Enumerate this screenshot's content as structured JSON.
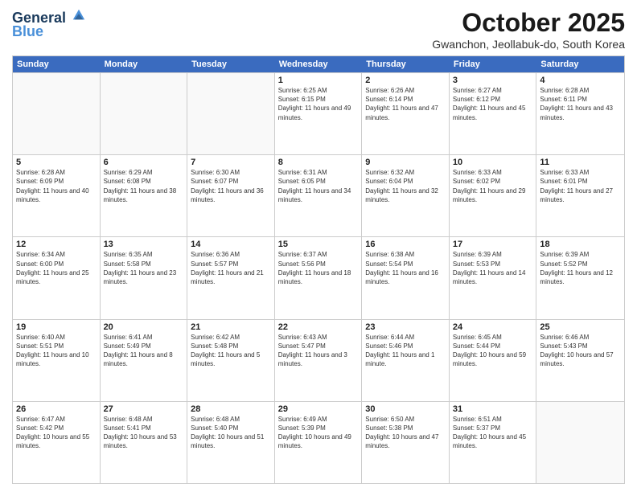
{
  "header": {
    "logo_line1": "General",
    "logo_line2": "Blue",
    "month": "October 2025",
    "location": "Gwanchon, Jeollabuk-do, South Korea"
  },
  "days_of_week": [
    "Sunday",
    "Monday",
    "Tuesday",
    "Wednesday",
    "Thursday",
    "Friday",
    "Saturday"
  ],
  "rows": [
    [
      {
        "day": "",
        "empty": true
      },
      {
        "day": "",
        "empty": true
      },
      {
        "day": "",
        "empty": true
      },
      {
        "day": "1",
        "sunrise": "Sunrise: 6:25 AM",
        "sunset": "Sunset: 6:15 PM",
        "daylight": "Daylight: 11 hours and 49 minutes."
      },
      {
        "day": "2",
        "sunrise": "Sunrise: 6:26 AM",
        "sunset": "Sunset: 6:14 PM",
        "daylight": "Daylight: 11 hours and 47 minutes."
      },
      {
        "day": "3",
        "sunrise": "Sunrise: 6:27 AM",
        "sunset": "Sunset: 6:12 PM",
        "daylight": "Daylight: 11 hours and 45 minutes."
      },
      {
        "day": "4",
        "sunrise": "Sunrise: 6:28 AM",
        "sunset": "Sunset: 6:11 PM",
        "daylight": "Daylight: 11 hours and 43 minutes."
      }
    ],
    [
      {
        "day": "5",
        "sunrise": "Sunrise: 6:28 AM",
        "sunset": "Sunset: 6:09 PM",
        "daylight": "Daylight: 11 hours and 40 minutes."
      },
      {
        "day": "6",
        "sunrise": "Sunrise: 6:29 AM",
        "sunset": "Sunset: 6:08 PM",
        "daylight": "Daylight: 11 hours and 38 minutes."
      },
      {
        "day": "7",
        "sunrise": "Sunrise: 6:30 AM",
        "sunset": "Sunset: 6:07 PM",
        "daylight": "Daylight: 11 hours and 36 minutes."
      },
      {
        "day": "8",
        "sunrise": "Sunrise: 6:31 AM",
        "sunset": "Sunset: 6:05 PM",
        "daylight": "Daylight: 11 hours and 34 minutes."
      },
      {
        "day": "9",
        "sunrise": "Sunrise: 6:32 AM",
        "sunset": "Sunset: 6:04 PM",
        "daylight": "Daylight: 11 hours and 32 minutes."
      },
      {
        "day": "10",
        "sunrise": "Sunrise: 6:33 AM",
        "sunset": "Sunset: 6:02 PM",
        "daylight": "Daylight: 11 hours and 29 minutes."
      },
      {
        "day": "11",
        "sunrise": "Sunrise: 6:33 AM",
        "sunset": "Sunset: 6:01 PM",
        "daylight": "Daylight: 11 hours and 27 minutes."
      }
    ],
    [
      {
        "day": "12",
        "sunrise": "Sunrise: 6:34 AM",
        "sunset": "Sunset: 6:00 PM",
        "daylight": "Daylight: 11 hours and 25 minutes."
      },
      {
        "day": "13",
        "sunrise": "Sunrise: 6:35 AM",
        "sunset": "Sunset: 5:58 PM",
        "daylight": "Daylight: 11 hours and 23 minutes."
      },
      {
        "day": "14",
        "sunrise": "Sunrise: 6:36 AM",
        "sunset": "Sunset: 5:57 PM",
        "daylight": "Daylight: 11 hours and 21 minutes."
      },
      {
        "day": "15",
        "sunrise": "Sunrise: 6:37 AM",
        "sunset": "Sunset: 5:56 PM",
        "daylight": "Daylight: 11 hours and 18 minutes."
      },
      {
        "day": "16",
        "sunrise": "Sunrise: 6:38 AM",
        "sunset": "Sunset: 5:54 PM",
        "daylight": "Daylight: 11 hours and 16 minutes."
      },
      {
        "day": "17",
        "sunrise": "Sunrise: 6:39 AM",
        "sunset": "Sunset: 5:53 PM",
        "daylight": "Daylight: 11 hours and 14 minutes."
      },
      {
        "day": "18",
        "sunrise": "Sunrise: 6:39 AM",
        "sunset": "Sunset: 5:52 PM",
        "daylight": "Daylight: 11 hours and 12 minutes."
      }
    ],
    [
      {
        "day": "19",
        "sunrise": "Sunrise: 6:40 AM",
        "sunset": "Sunset: 5:51 PM",
        "daylight": "Daylight: 11 hours and 10 minutes."
      },
      {
        "day": "20",
        "sunrise": "Sunrise: 6:41 AM",
        "sunset": "Sunset: 5:49 PM",
        "daylight": "Daylight: 11 hours and 8 minutes."
      },
      {
        "day": "21",
        "sunrise": "Sunrise: 6:42 AM",
        "sunset": "Sunset: 5:48 PM",
        "daylight": "Daylight: 11 hours and 5 minutes."
      },
      {
        "day": "22",
        "sunrise": "Sunrise: 6:43 AM",
        "sunset": "Sunset: 5:47 PM",
        "daylight": "Daylight: 11 hours and 3 minutes."
      },
      {
        "day": "23",
        "sunrise": "Sunrise: 6:44 AM",
        "sunset": "Sunset: 5:46 PM",
        "daylight": "Daylight: 11 hours and 1 minute."
      },
      {
        "day": "24",
        "sunrise": "Sunrise: 6:45 AM",
        "sunset": "Sunset: 5:44 PM",
        "daylight": "Daylight: 10 hours and 59 minutes."
      },
      {
        "day": "25",
        "sunrise": "Sunrise: 6:46 AM",
        "sunset": "Sunset: 5:43 PM",
        "daylight": "Daylight: 10 hours and 57 minutes."
      }
    ],
    [
      {
        "day": "26",
        "sunrise": "Sunrise: 6:47 AM",
        "sunset": "Sunset: 5:42 PM",
        "daylight": "Daylight: 10 hours and 55 minutes."
      },
      {
        "day": "27",
        "sunrise": "Sunrise: 6:48 AM",
        "sunset": "Sunset: 5:41 PM",
        "daylight": "Daylight: 10 hours and 53 minutes."
      },
      {
        "day": "28",
        "sunrise": "Sunrise: 6:48 AM",
        "sunset": "Sunset: 5:40 PM",
        "daylight": "Daylight: 10 hours and 51 minutes."
      },
      {
        "day": "29",
        "sunrise": "Sunrise: 6:49 AM",
        "sunset": "Sunset: 5:39 PM",
        "daylight": "Daylight: 10 hours and 49 minutes."
      },
      {
        "day": "30",
        "sunrise": "Sunrise: 6:50 AM",
        "sunset": "Sunset: 5:38 PM",
        "daylight": "Daylight: 10 hours and 47 minutes."
      },
      {
        "day": "31",
        "sunrise": "Sunrise: 6:51 AM",
        "sunset": "Sunset: 5:37 PM",
        "daylight": "Daylight: 10 hours and 45 minutes."
      },
      {
        "day": "",
        "empty": true
      }
    ]
  ]
}
